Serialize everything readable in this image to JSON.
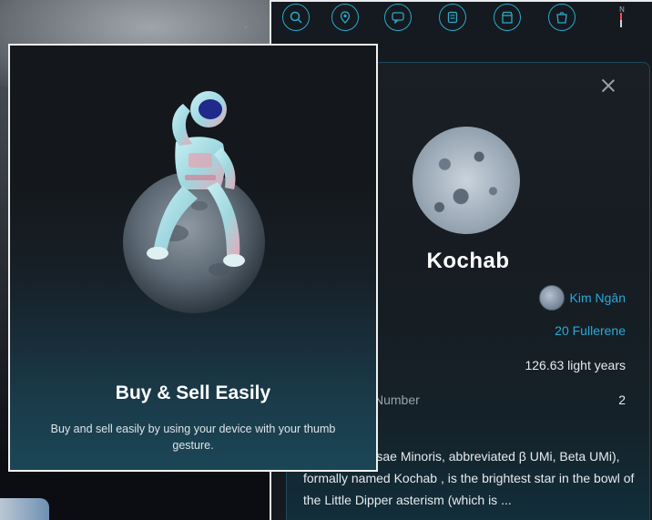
{
  "toolbar": {
    "items": [
      {
        "icon": "search-icon"
      },
      {
        "icon": "location-icon"
      },
      {
        "icon": "chat-icon"
      },
      {
        "icon": "document-icon"
      },
      {
        "icon": "store-icon"
      },
      {
        "icon": "shop-icon"
      }
    ],
    "compass_label": "N"
  },
  "detail": {
    "star_name": "Kochab",
    "owner_name": "Kim Ngân",
    "price": "20 Fullerene",
    "distance": "126.63 light years",
    "number_label": "Number",
    "number_value": "2",
    "description": "Minoris (β Ursae Minoris, abbreviated β UMi, Beta UMi), formally named Kochab , is the brightest star in the bowl of the Little Dipper asterism (which is ..."
  },
  "onboarding": {
    "title": "Buy & Sell Easily",
    "description": "Buy and sell easily by using your device with your thumb gesture."
  },
  "colors": {
    "accent": "#2aa9d6",
    "panel": "#151a20",
    "modal_bottom": "#1b4656"
  }
}
